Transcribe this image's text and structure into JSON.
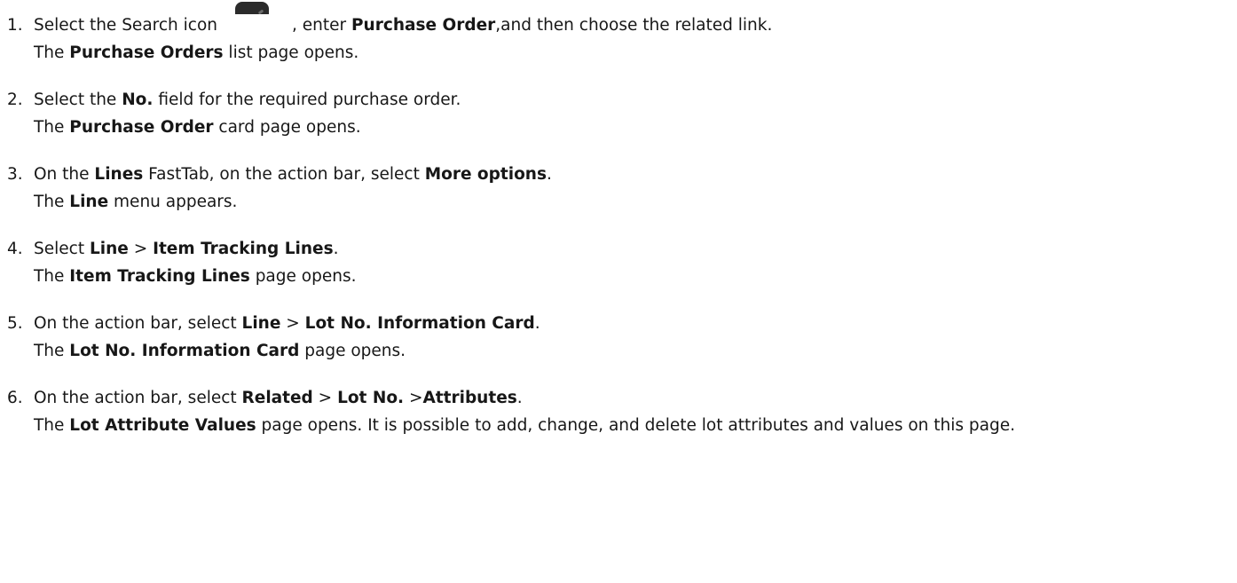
{
  "steps": [
    {
      "num": "1.",
      "instruction": [
        {
          "text": "Select the Search icon",
          "bold": false
        },
        {
          "icon": "search-icon"
        },
        {
          "text": ", enter ",
          "bold": false
        },
        {
          "text": "Purchase Order",
          "bold": true
        },
        {
          "text": ",and then choose the related link.",
          "bold": false
        }
      ],
      "result": [
        {
          "text": "The ",
          "bold": false
        },
        {
          "text": "Purchase Orders",
          "bold": true
        },
        {
          "text": " list page opens.",
          "bold": false
        }
      ]
    },
    {
      "num": "2.",
      "instruction": [
        {
          "text": "Select the ",
          "bold": false
        },
        {
          "text": "No.",
          "bold": true
        },
        {
          "text": " field for the required purchase order.",
          "bold": false
        }
      ],
      "result": [
        {
          "text": "The ",
          "bold": false
        },
        {
          "text": "Purchase Order",
          "bold": true
        },
        {
          "text": " card page opens.",
          "bold": false
        }
      ]
    },
    {
      "num": "3.",
      "instruction": [
        {
          "text": "On the ",
          "bold": false
        },
        {
          "text": "Lines",
          "bold": true
        },
        {
          "text": " FastTab, on the action bar, select ",
          "bold": false
        },
        {
          "text": "More options",
          "bold": true
        },
        {
          "text": ".",
          "bold": false
        }
      ],
      "result": [
        {
          "text": "The ",
          "bold": false
        },
        {
          "text": "Line",
          "bold": true
        },
        {
          "text": " menu appears.",
          "bold": false
        }
      ]
    },
    {
      "num": "4.",
      "instruction": [
        {
          "text": "Select ",
          "bold": false
        },
        {
          "text": "Line",
          "bold": true
        },
        {
          "text": " > ",
          "bold": false
        },
        {
          "text": "Item Tracking Lines",
          "bold": true
        },
        {
          "text": ".",
          "bold": false
        }
      ],
      "result": [
        {
          "text": "The ",
          "bold": false
        },
        {
          "text": "Item Tracking Lines",
          "bold": true
        },
        {
          "text": " page opens.",
          "bold": false
        }
      ]
    },
    {
      "num": "5.",
      "instruction": [
        {
          "text": "On the action bar, select ",
          "bold": false
        },
        {
          "text": "Line",
          "bold": true
        },
        {
          "text": " > ",
          "bold": false
        },
        {
          "text": "Lot No. Information Card",
          "bold": true
        },
        {
          "text": ".",
          "bold": false
        }
      ],
      "result": [
        {
          "text": "The ",
          "bold": false
        },
        {
          "text": "Lot No. Information Card",
          "bold": true
        },
        {
          "text": " page opens.",
          "bold": false
        }
      ]
    },
    {
      "num": "6.",
      "instruction": [
        {
          "text": "On the action bar, select ",
          "bold": false
        },
        {
          "text": "Related",
          "bold": true
        },
        {
          "text": " > ",
          "bold": false
        },
        {
          "text": "Lot No.",
          "bold": true
        },
        {
          "text": " >",
          "bold": false
        },
        {
          "text": "Attributes",
          "bold": true
        },
        {
          "text": ".",
          "bold": false
        }
      ],
      "result": [
        {
          "text": "The ",
          "bold": false
        },
        {
          "text": "Lot Attribute Values",
          "bold": true
        },
        {
          "text": " page opens. It is possible to add, change, and delete lot attributes and values on this page.",
          "bold": false
        }
      ]
    }
  ]
}
